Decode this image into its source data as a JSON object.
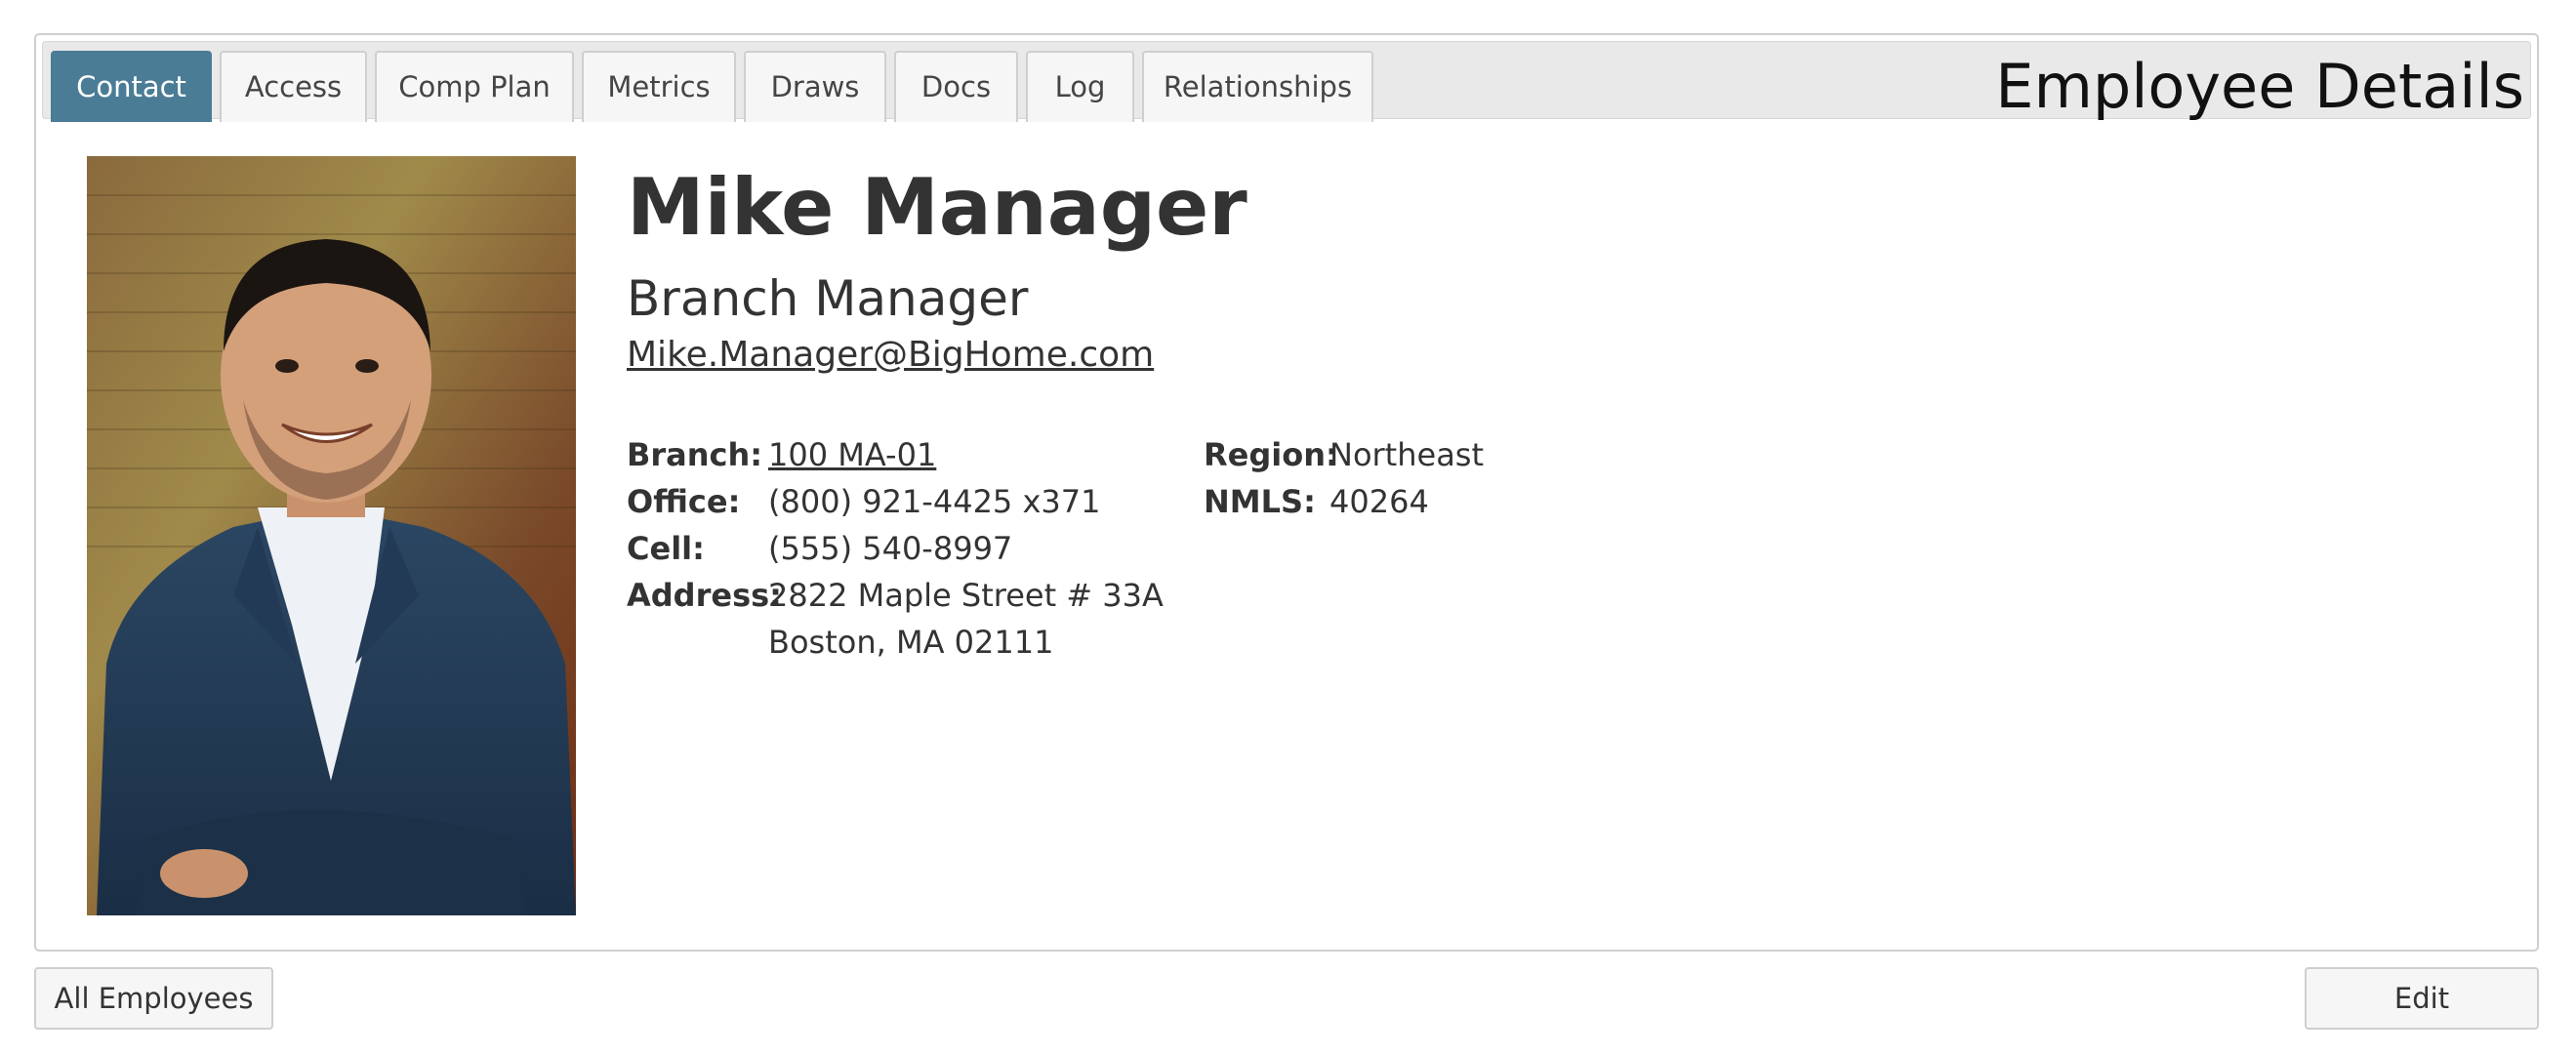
{
  "tabs": [
    {
      "label": "Contact"
    },
    {
      "label": "Access"
    },
    {
      "label": "Comp Plan"
    },
    {
      "label": "Metrics"
    },
    {
      "label": "Draws"
    },
    {
      "label": "Docs"
    },
    {
      "label": "Log"
    },
    {
      "label": "Relationships"
    }
  ],
  "active_tab": "Contact",
  "header": {
    "title": "Employee Details"
  },
  "employee": {
    "name": "Mike Manager",
    "title": "Branch Manager",
    "email": "Mike.Manager@BigHome.com"
  },
  "details": {
    "branch_label": "Branch:",
    "branch_value": "100 MA-01",
    "office_label": "Office:",
    "office_value": "(800) 921-4425 x371",
    "cell_label": "Cell:",
    "cell_value": "(555) 540-8997",
    "address_label": "Address:",
    "address_line1": "2822 Maple Street # 33A",
    "address_line2": "Boston, MA 02111",
    "region_label": "Region:",
    "region_value": "Northeast",
    "nmls_label": "NMLS:",
    "nmls_value": "40264"
  },
  "footer": {
    "all_employees_label": "All Employees",
    "edit_label": "Edit"
  },
  "colors": {
    "accent": "#4a7c96",
    "tab_bg": "#f6f6f6",
    "text": "#333333"
  }
}
